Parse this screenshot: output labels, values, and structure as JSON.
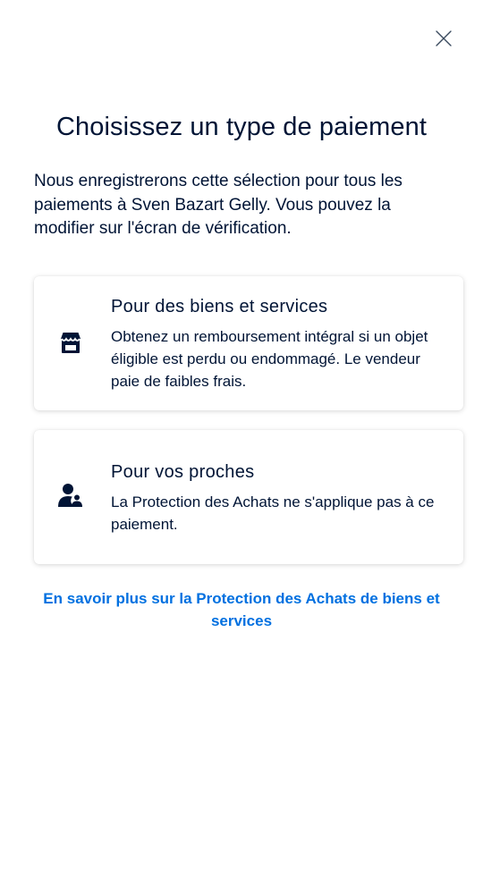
{
  "dialog": {
    "close_icon": "close-icon",
    "title": "Choisissez un type de paiement",
    "description": "Nous enregistrerons cette sélection pour tous les paiements à Sven Bazart Gelly. Vous pouvez la modifier sur l'écran de vérification."
  },
  "options": [
    {
      "icon": "storefront-icon",
      "title": "Pour des biens et services",
      "body": "Obtenez un remboursement intégral si un objet éligible est perdu ou endommagé. Le vendeur paie de faibles frais."
    },
    {
      "icon": "friends-icon",
      "title": "Pour vos proches",
      "body": "La Protection des Achats ne s'applique pas à ce paiement."
    }
  ],
  "learn_more_link": "En savoir plus sur la Protection des Achats de biens et services",
  "colors": {
    "text": "#001435",
    "link": "#0070e0",
    "background": "#ffffff"
  }
}
